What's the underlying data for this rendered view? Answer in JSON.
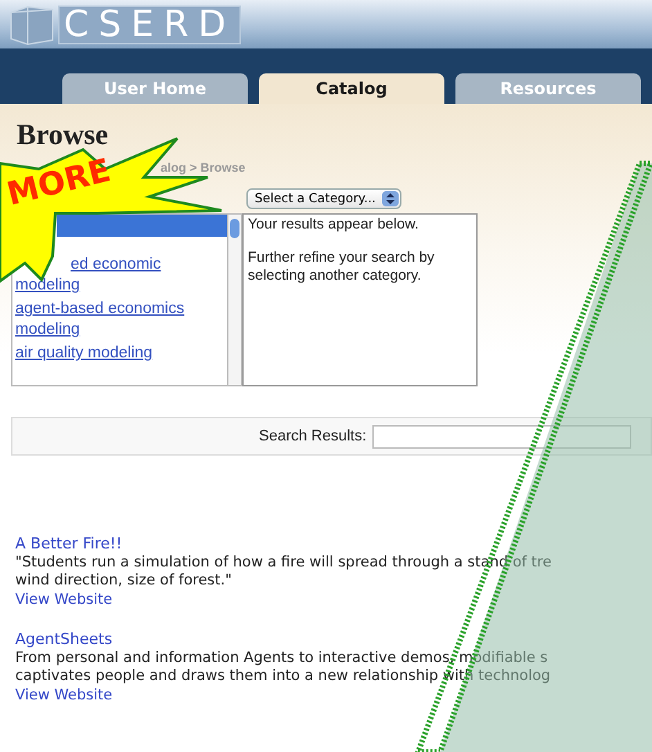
{
  "header": {
    "logo": "CSERD"
  },
  "tabs": [
    {
      "label": "User Home",
      "selected": false
    },
    {
      "label": "Catalog",
      "selected": true
    },
    {
      "label": "Resources",
      "selected": false
    }
  ],
  "heading": "Browse",
  "breadcrumb": "alog > Browse",
  "category_select": {
    "value": "Select a Category..."
  },
  "category_list": [
    {
      "selected": true
    },
    {
      "label": "ed economic modeling",
      "selected": false
    },
    {
      "label": "agent-based economics modeling",
      "selected": false
    },
    {
      "label": "air quality modeling",
      "selected": false
    }
  ],
  "results_note": [
    "Your results appear below.",
    "Further refine your search by selecting another category."
  ],
  "search": {
    "label": "Search Results:"
  },
  "results": [
    {
      "title": "A Better Fire!!",
      "lines": [
        "\"Students run a simulation of how a fire will spread through a stand of tre",
        "wind direction, size of forest.\""
      ],
      "link": "View Website"
    },
    {
      "title": "AgentSheets",
      "lines": [
        "From personal and information Agents to interactive demos, modifiable s",
        "captivates people and draws them into a new relationship with technolog"
      ],
      "link": "View Website"
    }
  ],
  "callout": {
    "text": "MORE"
  }
}
